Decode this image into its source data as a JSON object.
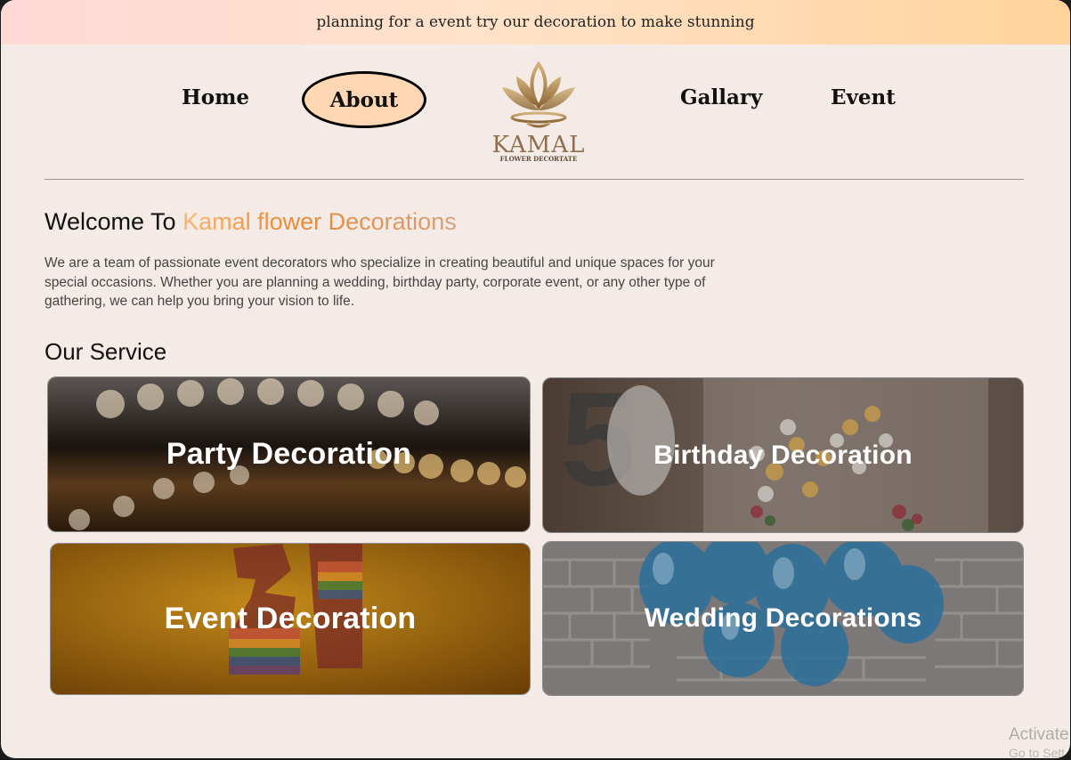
{
  "topbar": {
    "message": "planning for a event try our decoration to make stunning"
  },
  "nav": {
    "home": "Home",
    "about": "About",
    "gallery": "Gallary",
    "event": "Event"
  },
  "logo": {
    "name": "KAMAL",
    "tagline": "FLOWER DECORTATE"
  },
  "hero": {
    "welcome_prefix": "Welcome To ",
    "brand": "Kamal flower Decorations",
    "intro": "We are a team of passionate event decorators who specialize in creating beautiful and unique spaces for your special occasions. Whether you are planning a wedding, birthday party, corporate event, or any other type of gathering, we can help you bring your vision to life."
  },
  "services": {
    "title": "Our Service",
    "items": [
      {
        "label": "Party Decoration"
      },
      {
        "label": "Birthday Decoration"
      },
      {
        "label": "Event Decoration"
      },
      {
        "label": "Wedding Decorations"
      }
    ]
  },
  "watermark": {
    "line1": "Activate",
    "line2": "Go to Sett"
  },
  "colors": {
    "accent": "#e58a36",
    "topbar_start": "#ffd9d6",
    "topbar_end": "#ffd39c",
    "page_bg": "#f4ebe6"
  }
}
